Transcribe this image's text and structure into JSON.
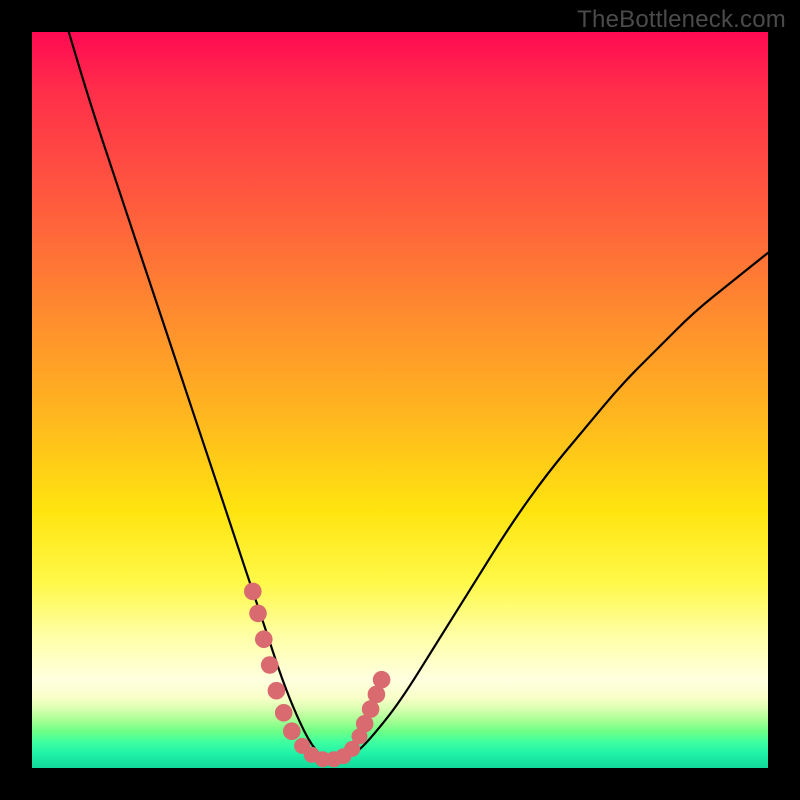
{
  "watermark": "TheBottleneck.com",
  "colors": {
    "background": "#000000",
    "curve": "#000000",
    "marker": "#d96a6f",
    "gradient_top": "#ff0a52",
    "gradient_mid": "#ffe40f",
    "gradient_bottom": "#12d89a"
  },
  "chart_data": {
    "type": "line",
    "title": "",
    "xlabel": "",
    "ylabel": "",
    "xlim": [
      0,
      100
    ],
    "ylim": [
      0,
      100
    ],
    "grid": false,
    "legend": false,
    "series": [
      {
        "name": "bottleneck-curve",
        "x": [
          5,
          8,
          12,
          16,
          20,
          24,
          28,
          30,
          32,
          34,
          36,
          38,
          40,
          42,
          44,
          46,
          50,
          55,
          60,
          65,
          70,
          75,
          80,
          85,
          90,
          95,
          100
        ],
        "y": [
          100,
          90,
          78,
          66,
          54,
          42,
          30,
          24,
          18,
          12,
          7,
          3,
          1,
          1,
          2,
          4,
          9,
          17,
          25,
          33,
          40,
          46,
          52,
          57,
          62,
          66,
          70
        ]
      }
    ],
    "markers": [
      {
        "x": 30,
        "y": 24,
        "r": 1.1
      },
      {
        "x": 30.7,
        "y": 21,
        "r": 1.1
      },
      {
        "x": 31.5,
        "y": 17.5,
        "r": 1.1
      },
      {
        "x": 32.3,
        "y": 14,
        "r": 1.1
      },
      {
        "x": 33.2,
        "y": 10.5,
        "r": 1.1
      },
      {
        "x": 34.2,
        "y": 7.5,
        "r": 1.1
      },
      {
        "x": 35.3,
        "y": 5,
        "r": 1.1
      },
      {
        "x": 36.7,
        "y": 3,
        "r": 1.0
      },
      {
        "x": 38,
        "y": 1.8,
        "r": 1.0
      },
      {
        "x": 39.5,
        "y": 1.2,
        "r": 1.0
      },
      {
        "x": 41,
        "y": 1.2,
        "r": 1.0
      },
      {
        "x": 42.3,
        "y": 1.6,
        "r": 1.0
      },
      {
        "x": 43.5,
        "y": 2.6,
        "r": 1.0
      },
      {
        "x": 44.5,
        "y": 4.3,
        "r": 1.0
      },
      {
        "x": 45.2,
        "y": 6,
        "r": 1.1
      },
      {
        "x": 46,
        "y": 8,
        "r": 1.1
      },
      {
        "x": 46.8,
        "y": 10,
        "r": 1.1
      },
      {
        "x": 47.5,
        "y": 12,
        "r": 1.1
      }
    ]
  }
}
